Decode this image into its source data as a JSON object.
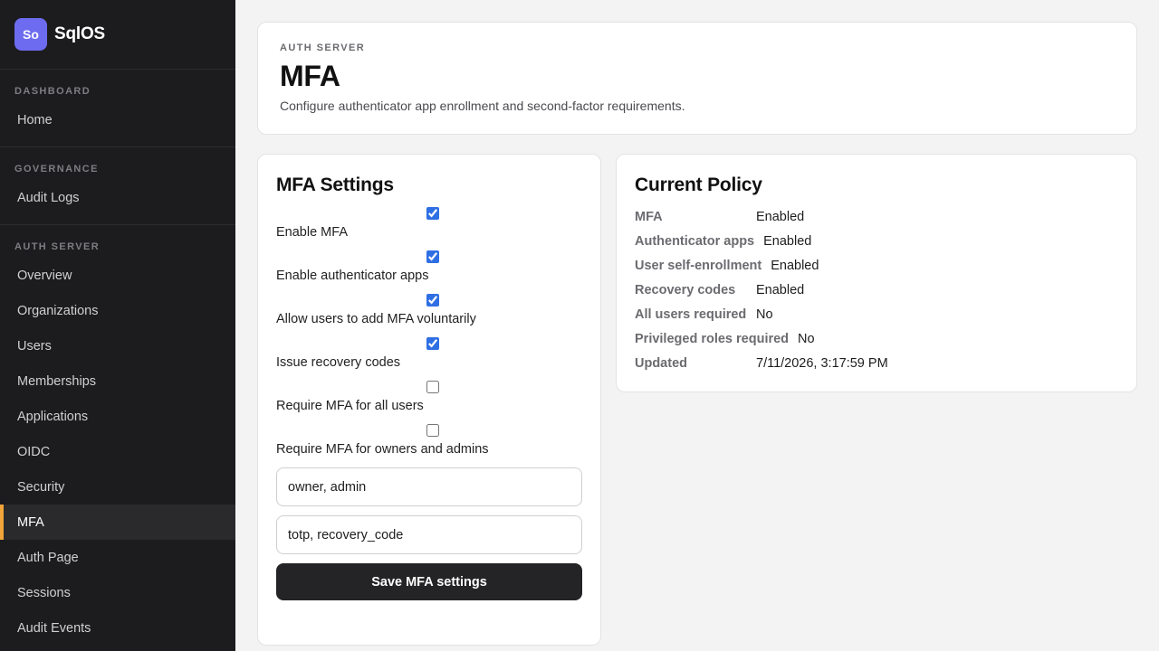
{
  "brand": {
    "logo": "So",
    "name": "SqlOS"
  },
  "sidebar": {
    "sections": [
      {
        "title": "DASHBOARD",
        "items": [
          "Home"
        ]
      },
      {
        "title": "GOVERNANCE",
        "items": [
          "Audit Logs"
        ]
      },
      {
        "title": "AUTH SERVER",
        "items": [
          "Overview",
          "Organizations",
          "Users",
          "Memberships",
          "Applications",
          "OIDC",
          "Security",
          "MFA",
          "Auth Page",
          "Sessions",
          "Audit Events"
        ]
      }
    ],
    "active_item": "MFA"
  },
  "header": {
    "eyebrow": "AUTH SERVER",
    "title": "MFA",
    "description": "Configure authenticator app enrollment and second-factor requirements."
  },
  "settings": {
    "title": "MFA Settings",
    "options": [
      {
        "label": "Enable MFA",
        "checked": true
      },
      {
        "label": "Enable authenticator apps",
        "checked": true
      },
      {
        "label": "Allow users to add MFA voluntarily",
        "checked": true
      },
      {
        "label": "Issue recovery codes",
        "checked": true
      },
      {
        "label": "Require MFA for all users",
        "checked": false
      },
      {
        "label": "Require MFA for owners and admins",
        "checked": false
      }
    ],
    "roles_value": "owner, admin",
    "factors_value": "totp, recovery_code",
    "save_label": "Save MFA settings"
  },
  "policy": {
    "title": "Current Policy",
    "rows": [
      {
        "key": "MFA",
        "value": "Enabled"
      },
      {
        "key": "Authenticator apps",
        "value": "Enabled"
      },
      {
        "key": "User self-enrollment",
        "value": "Enabled"
      },
      {
        "key": "Recovery codes",
        "value": "Enabled"
      },
      {
        "key": "All users required",
        "value": "No"
      },
      {
        "key": "Privileged roles required",
        "value": "No"
      },
      {
        "key": "Updated",
        "value": "7/11/2026, 3:17:59 PM"
      }
    ]
  },
  "colors": {
    "accent": "#6d6cf0",
    "active_indicator": "#f0a43a",
    "checkbox": "#2f6fe4",
    "sidebar_bg": "#1c1c1e"
  }
}
